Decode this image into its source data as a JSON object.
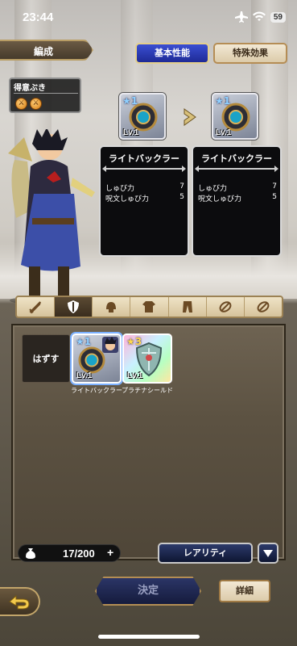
{
  "status_bar": {
    "time": "23:44",
    "battery": "59"
  },
  "header": {
    "section_label": "編成",
    "tab_basic": "基本性能",
    "tab_special": "特殊効果"
  },
  "favorite_weapon": {
    "title": "得意ぶき"
  },
  "compare": {
    "current": {
      "name": "ライトバックラー",
      "level": "Lv.1",
      "stars": "★1",
      "stats": [
        {
          "label": "しゅび力",
          "value": "7"
        },
        {
          "label": "呪文しゅび力",
          "value": "5"
        }
      ]
    },
    "selected": {
      "name": "ライトバックラー",
      "level": "Lv.1",
      "stars": "★1",
      "stats": [
        {
          "label": "しゅび力",
          "value": "7"
        },
        {
          "label": "呪文しゅび力",
          "value": "5"
        }
      ]
    }
  },
  "category_tabs": [
    {
      "name": "weapon",
      "icon": "sword-icon"
    },
    {
      "name": "shield",
      "icon": "shield-icon",
      "active": true
    },
    {
      "name": "head",
      "icon": "helmet-icon"
    },
    {
      "name": "body-upper",
      "icon": "armor-icon"
    },
    {
      "name": "body-lower",
      "icon": "pants-icon"
    },
    {
      "name": "accessory-1",
      "icon": "accessory-icon"
    },
    {
      "name": "accessory-2",
      "icon": "accessory-icon"
    }
  ],
  "inventory": {
    "unequip_label": "はずす",
    "items": [
      {
        "name": "ライトバックラー",
        "level": "Lv.1",
        "stars": "★1"
      },
      {
        "name": "プラチナシールド",
        "level": "Lv.1",
        "stars": "★3"
      }
    ],
    "capacity": "17/200",
    "plus": "+",
    "sort_label": "レアリティ"
  },
  "footer": {
    "confirm_label": "決定",
    "detail_label": "詳細"
  },
  "colors": {
    "accent_blue": "#1e2a96",
    "gold_border": "#b89c64"
  }
}
